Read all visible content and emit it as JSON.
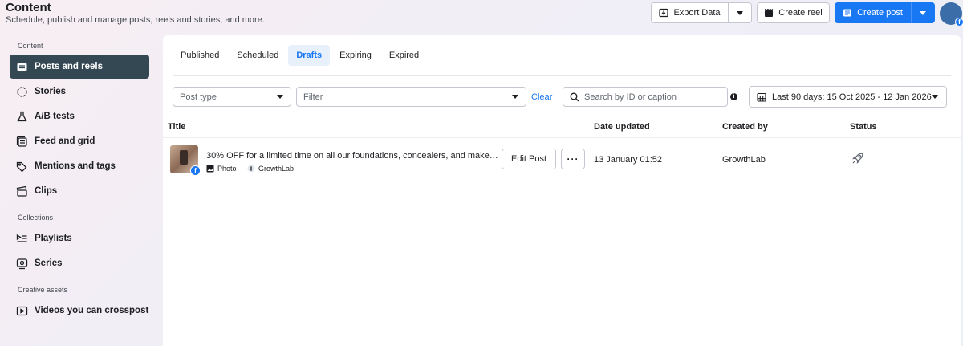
{
  "header": {
    "title": "Content",
    "subtitle": "Schedule, publish and manage posts, reels and stories, and more.",
    "export_label": "Export Data",
    "create_reel_label": "Create reel",
    "create_post_label": "Create post",
    "accent": "#1877f2"
  },
  "sidebar": {
    "sections": {
      "content": "Content",
      "collections": "Collections",
      "creative_assets": "Creative assets"
    },
    "items": [
      {
        "label": "Posts and reels",
        "icon": "posts-icon"
      },
      {
        "label": "Stories",
        "icon": "stories-icon"
      },
      {
        "label": "A/B tests",
        "icon": "flask-icon"
      },
      {
        "label": "Feed and grid",
        "icon": "grid-icon"
      },
      {
        "label": "Mentions and tags",
        "icon": "tag-icon"
      },
      {
        "label": "Clips",
        "icon": "clapper-icon"
      },
      {
        "label": "Playlists",
        "icon": "playlist-icon"
      },
      {
        "label": "Series",
        "icon": "series-icon"
      },
      {
        "label": "Videos you can crosspost",
        "icon": "video-icon"
      }
    ],
    "active_color": "#344854"
  },
  "tabs": [
    "Published",
    "Scheduled",
    "Drafts",
    "Expiring",
    "Expired"
  ],
  "active_tab": "Drafts",
  "filters": {
    "post_type_placeholder": "Post type",
    "filter_placeholder": "Filter",
    "clear_label": "Clear",
    "search_placeholder": "Search by ID or caption",
    "date_range": "Last 90 days: 15 Oct 2025 - 12 Jan 2026"
  },
  "table": {
    "columns": [
      "Title",
      "Date updated",
      "Created by",
      "Status"
    ],
    "rows": [
      {
        "caption": "30% OFF for a limited time on all our foundations, concealers, and makeup ...",
        "media_type": "Photo ·",
        "page": "GrowthLab",
        "edit_label": "Edit Post",
        "date_updated": "13 January 01:52",
        "created_by": "GrowthLab",
        "status_icon": "rocket-icon"
      }
    ]
  }
}
